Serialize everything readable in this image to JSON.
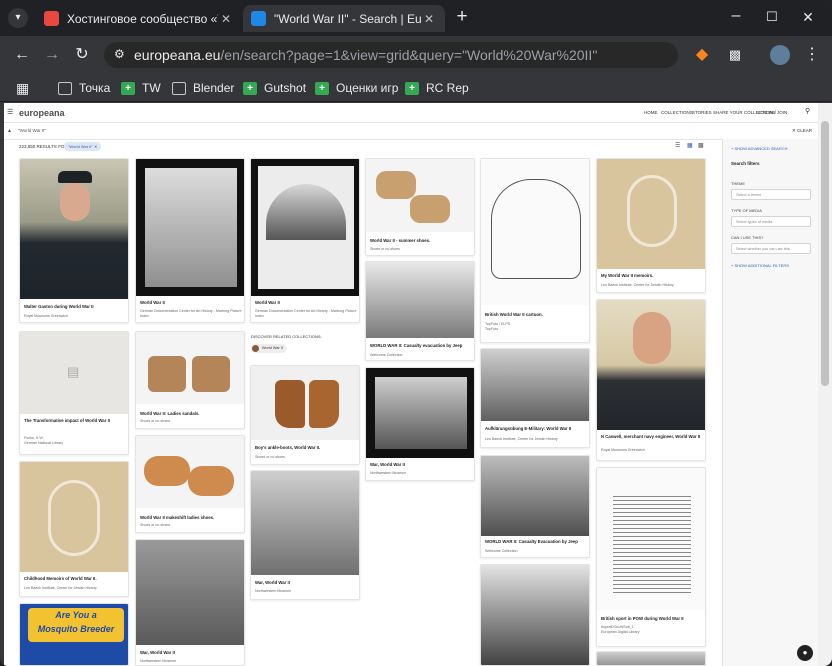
{
  "tabs": [
    {
      "title": "Хостинговое сообщество «Tim",
      "active": false,
      "favicon": "play-icon",
      "favicon_color": "#e8483f"
    },
    {
      "title": "\"World War II\" - Search | Europe",
      "active": true,
      "favicon": "europeana-icon",
      "favicon_color": "#1d88e5"
    }
  ],
  "toolbar": {
    "url_domain": "europeana.eu",
    "url_path": "/en/search?page=1&view=grid&query=\"World%20War%20II\""
  },
  "bookmarks": [
    {
      "label": "",
      "icon": "apps-grid-icon"
    },
    {
      "label": "Точка",
      "icon": "folder-icon"
    },
    {
      "label": "TW",
      "icon": "green-bookmark-icon"
    },
    {
      "label": "Blender",
      "icon": "folder-icon"
    },
    {
      "label": "Gutshot",
      "icon": "green-bookmark-icon"
    },
    {
      "label": "Оценки игр",
      "icon": "green-bookmark-icon"
    },
    {
      "label": "RC Rep",
      "icon": "green-bookmark-icon"
    }
  ],
  "site": {
    "logo": "europeana",
    "nav": [
      "HOME",
      "COLLECTIONS",
      "STORIES",
      "SHARE YOUR COLLECTIONS",
      "LOG IN / JOIN"
    ],
    "query": "\"World War II\"",
    "clear": "CLEAR",
    "results_label": "223,650 RESULTS FOR",
    "results_chip": "\"World War II\""
  },
  "sidebar": {
    "advanced": "+ SHOW ADVANCED SEARCH",
    "filters_title": "Search filters",
    "theme_label": "THEME",
    "theme_placeholder": "Select a theme",
    "type_label": "TYPE OF MEDIA",
    "type_placeholder": "Select types of media",
    "reuse_label": "CAN I USE THIS?",
    "reuse_placeholder": "Select whether you can use this",
    "additional": "+ SHOW ADDITIONAL FILTERS"
  },
  "related": {
    "label": "DISCOVER RELATED COLLECTIONS:",
    "chip": "World War II"
  },
  "cards": [
    {
      "title": "Walter Gaston during World War II",
      "sub": "Royal Museums Greenwich"
    },
    {
      "title": "The Transformative impact of World War II",
      "sub": "Funke, K.W.\nGerman National Library"
    },
    {
      "title": "Childhood Memoirs of World War II.",
      "sub": "Leo Baeck Institute, Center for Jewish History"
    },
    {
      "title": "World War II",
      "sub": "German Documentation Center for Art History - Marburg Picture Index"
    },
    {
      "title": "World War II: Ladies sandals.",
      "sub": "Shoes or no shoes"
    },
    {
      "title": "World War II makeshift ladies shoes.",
      "sub": "Shoes or no shoes"
    },
    {
      "title": "War, World War II",
      "sub": "Northwestern Museum"
    },
    {
      "title": "World War II",
      "sub": "German Documentation Center for Art History - Marburg Picture Index"
    },
    {
      "title": "Boy's ankle-boots, World War II.",
      "sub": "Shoes or no shoes"
    },
    {
      "title": "War, World War II",
      "sub": "Northwestern Museum"
    },
    {
      "title": "World War II - summer shoes.",
      "sub": "Shoes or no shoes"
    },
    {
      "title": "WORLD WAR II: Casualty evacuation by Jeep",
      "sub": "Wellcome Collection"
    },
    {
      "title": "War, World War II",
      "sub": "Northwestern Museum"
    },
    {
      "title": "British World War II cartoon.",
      "sub": "TopFoto / ELPS\nTopFoto"
    },
    {
      "title": "Aufklärungsübung E-Military: World War II",
      "sub": "Leo Baeck Institute, Center for Jewish History"
    },
    {
      "title": "WORLD WAR II: Casualty Evacuation by Jeep",
      "sub": "Wellcome Collection"
    },
    {
      "title": "My World War II memoirs.",
      "sub": "Leo Baeck Institute, Center for Jewish History"
    },
    {
      "title": "N Caswell, merchant navy engineer, World War II",
      "sub": "Royal Museums Greenwich"
    },
    {
      "title": "British sport in POW during World War II",
      "sub": "#sportDOccWSub_1\nEuropean Digital Library"
    }
  ],
  "colors": {
    "accent": "#2b5dbd",
    "chrome_bg": "#35363a",
    "tabstrip_bg": "#202124"
  }
}
